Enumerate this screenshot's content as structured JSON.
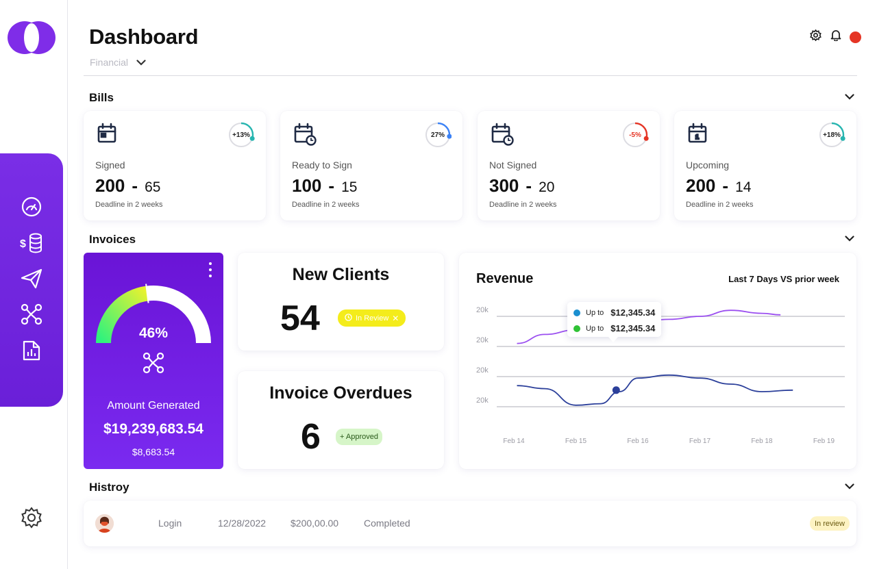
{
  "header": {
    "title": "Dashboard",
    "subtitle": "Financial"
  },
  "sidebar": {
    "items": [
      {
        "icon": "speedometer-icon"
      },
      {
        "icon": "dollar-database-icon"
      },
      {
        "icon": "send-icon"
      },
      {
        "icon": "share-nodes-icon"
      },
      {
        "icon": "report-file-icon"
      }
    ],
    "bottom_icon": "gear-icon"
  },
  "sections": {
    "bills": "Bills",
    "invoices": "Invoices",
    "history": "Histroy"
  },
  "bills": [
    {
      "label": "Signed",
      "total": "200",
      "count": "65",
      "deadline": "Deadline in 2 weeks",
      "change": "+13%",
      "ring_color": "#27b5b0",
      "progress": 0.3
    },
    {
      "label": "Ready  to Sign",
      "total": "100",
      "count": "15",
      "deadline": "Deadline in 2 weeks",
      "change": "27%",
      "ring_color": "#3b82f6",
      "progress": 0.27
    },
    {
      "label": "Not Signed",
      "total": "300",
      "count": "20",
      "deadline": "Deadline in 2 weeks",
      "change": "-5%",
      "ring_color": "#e53525",
      "progress": 0.3
    },
    {
      "label": "Upcoming",
      "total": "200",
      "count": "14",
      "deadline": "Deadline in 2 weeks",
      "change": "+18%",
      "ring_color": "#27b5b0",
      "progress": 0.3
    }
  ],
  "gauge": {
    "percent_label": "46%",
    "percent": 0.46,
    "label": "Amount Generated",
    "amount": "$19,239,683.54",
    "sub_amount": "$8,683.54"
  },
  "new_clients": {
    "title": "New Clients",
    "value": "54",
    "badge": "In Review"
  },
  "invoice_overdues": {
    "title": "Invoice Overdues",
    "value": "6",
    "badge": "+ Approved"
  },
  "revenue": {
    "title": "Revenue",
    "period": "Last 7 Days VS prior week",
    "tooltip": [
      {
        "label": "Up to",
        "value": "$12,345.34",
        "color": "#1a8fd0"
      },
      {
        "label": "Up to",
        "value": "$12,345.34",
        "color": "#2fc235"
      }
    ],
    "colors": {
      "current": "#9b4ff0",
      "prior": "#2b3f9a"
    }
  },
  "chart_data": {
    "type": "line",
    "title": "Revenue",
    "xlabel": "",
    "ylabel": "",
    "x": [
      "Feb 14",
      "Feb 15",
      "Feb 16",
      "Feb 17",
      "Feb 18",
      "Feb 19"
    ],
    "y_tick_labels": [
      "20k",
      "20k",
      "20k",
      "20k"
    ],
    "grid": true,
    "series": [],
    "lines": [
      {
        "color": "#9b4ff0",
        "points": [
          [
            0.05,
            2.1
          ],
          [
            0.5,
            2.4
          ],
          [
            1.0,
            2.55
          ],
          [
            1.4,
            2.6
          ],
          [
            1.6,
            2.75
          ],
          [
            2.0,
            2.8
          ],
          [
            2.5,
            2.9
          ],
          [
            3.0,
            3.0
          ],
          [
            3.5,
            3.2
          ],
          [
            4.0,
            3.1
          ],
          [
            4.3,
            3.05
          ]
        ]
      },
      {
        "color": "#2b3f9a",
        "points": [
          [
            0.05,
            0.7
          ],
          [
            0.5,
            0.6
          ],
          [
            1.0,
            0.05
          ],
          [
            1.4,
            0.1
          ],
          [
            1.7,
            0.5
          ],
          [
            2.0,
            0.95
          ],
          [
            2.5,
            1.05
          ],
          [
            3.0,
            0.95
          ],
          [
            3.5,
            0.75
          ],
          [
            4.0,
            0.5
          ],
          [
            4.5,
            0.55
          ]
        ]
      }
    ],
    "markers": [
      {
        "line": 0,
        "x": 1.65,
        "y": 2.75
      },
      {
        "line": 1,
        "x": 1.65,
        "y": 0.55
      }
    ]
  },
  "history": [
    {
      "action": "Login",
      "date": "12/28/2022",
      "amount": "$200,00.00",
      "status": "Completed",
      "badge": "In review"
    }
  ]
}
